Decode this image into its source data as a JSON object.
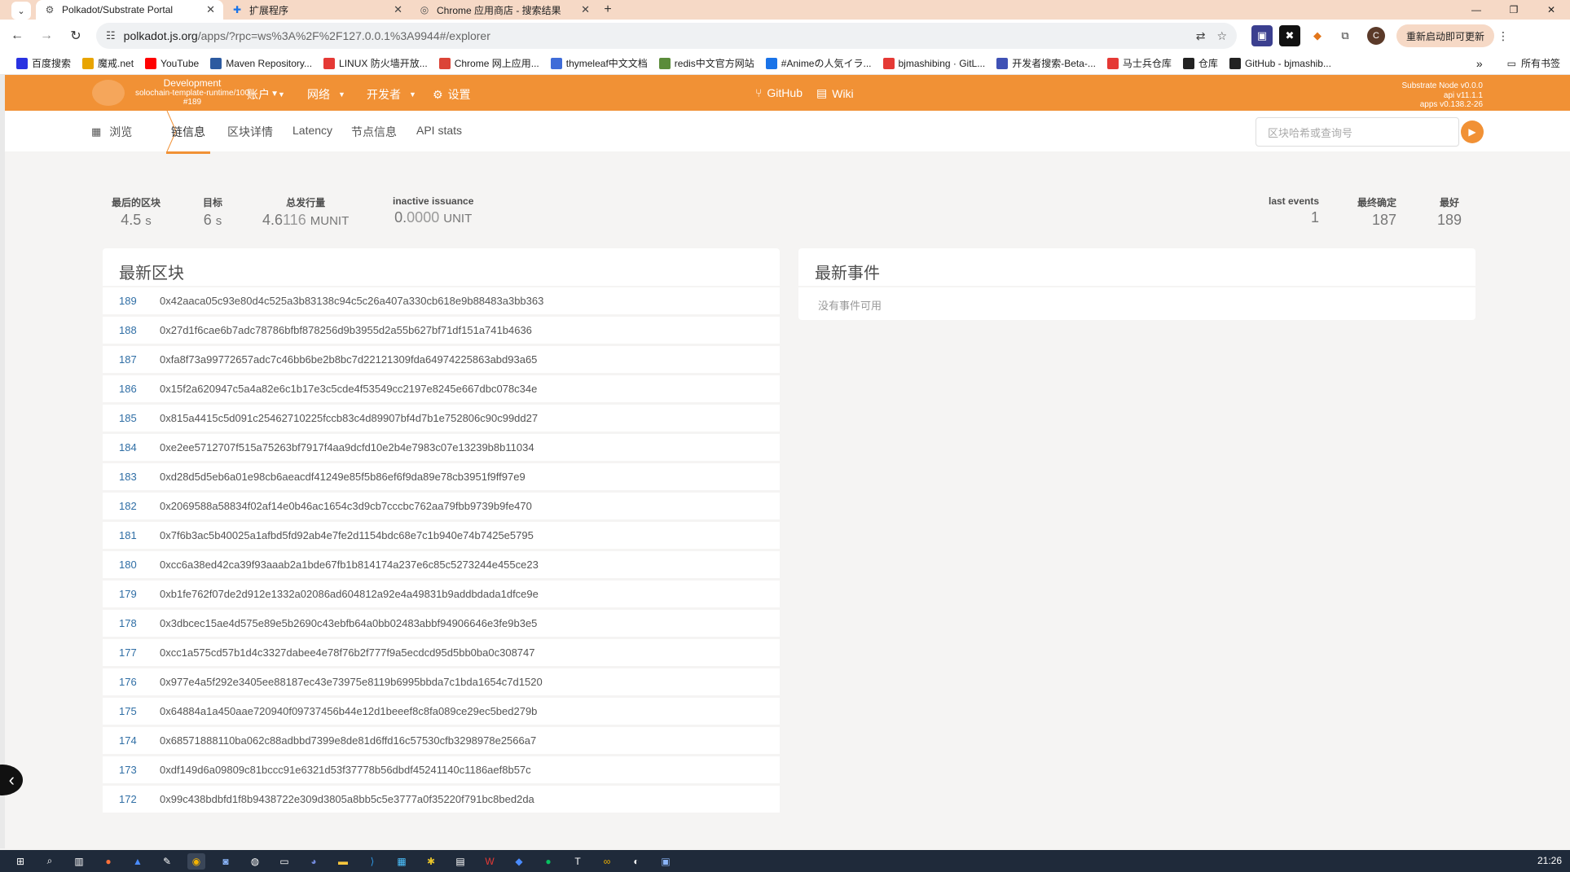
{
  "browser": {
    "tabs": [
      {
        "title": "Polkadot/Substrate Portal",
        "icon": "gear-icon",
        "active": true
      },
      {
        "title": "扩展程序",
        "icon": "puzzle-icon",
        "active": false
      },
      {
        "title": "Chrome 应用商店 - 搜索结果",
        "icon": "globe-icon",
        "active": false
      }
    ],
    "url_host": "polkadot.js.org",
    "url_path": "/apps/?rpc=ws%3A%2F%2F127.0.0.1%3A9944#/explorer",
    "profile_initial": "C",
    "update_label": "重新启动即可更新",
    "bookmarks": [
      {
        "label": "百度搜索",
        "color": "#2932e1"
      },
      {
        "label": "魔戒.net",
        "color": "#e8a400"
      },
      {
        "label": "YouTube",
        "color": "#ff0000"
      },
      {
        "label": "Maven Repository...",
        "color": "#2c5aa0"
      },
      {
        "label": "LINUX 防火墙开放...",
        "color": "#e53935"
      },
      {
        "label": "Chrome 网上应用...",
        "color": "#db4437"
      },
      {
        "label": "thymeleaf中文文档",
        "color": "#3f6cd8"
      },
      {
        "label": "redis中文官方网站",
        "color": "#5b8c3a"
      },
      {
        "label": "#Animeの人気イラ...",
        "color": "#1a73e8"
      },
      {
        "label": "bjmashibing · GitL...",
        "color": "#e53935"
      },
      {
        "label": "开发者搜索-Beta-...",
        "color": "#3f51b5"
      },
      {
        "label": "马士兵仓库",
        "color": "#e53935"
      },
      {
        "label": "仓库",
        "color": "#222222"
      },
      {
        "label": "GitHub - bjmashib...",
        "color": "#222222"
      }
    ],
    "all_bookmarks_label": "所有书签"
  },
  "header": {
    "network": "Development",
    "runtime": "solochain-template-runtime/100",
    "block": "#189",
    "menus": [
      {
        "label": "账户"
      },
      {
        "label": "网络"
      },
      {
        "label": "开发者"
      },
      {
        "label": "设置"
      }
    ],
    "links": [
      {
        "label": "GitHub"
      },
      {
        "label": "Wiki"
      }
    ],
    "node_name": "Substrate Node v0.0.0",
    "api_version": "api v11.1.1",
    "apps_version": "apps v0.138.2-26"
  },
  "subnav": {
    "browse_label": "浏览",
    "tabs": [
      "链信息",
      "区块详情",
      "Latency",
      "节点信息",
      "API stats"
    ],
    "search_placeholder": "区块哈希或查询号"
  },
  "stats": {
    "last_block": {
      "label": "最后的区块",
      "value": "4.5",
      "unit": "s"
    },
    "target": {
      "label": "目标",
      "value": "6",
      "unit": "s"
    },
    "total_issuance": {
      "label": "总发行量",
      "value_main": "4.6",
      "value_dim": "116",
      "unit": "MUNIT"
    },
    "inactive_issuance": {
      "label": "inactive issuance",
      "value_main": "0.",
      "value_dim": "0000",
      "unit": "UNIT"
    },
    "last_events": {
      "label": "last events",
      "value": "1"
    },
    "finalized": {
      "label": "最终确定",
      "value": "187"
    },
    "best": {
      "label": "最好",
      "value": "189"
    }
  },
  "recent_blocks": {
    "title": "最新区块",
    "rows": [
      {
        "number": "189",
        "hash": "0x42aaca05c93e80d4c525a3b83138c94c5c26a407a330cb618e9b88483a3bb363"
      },
      {
        "number": "188",
        "hash": "0x27d1f6cae6b7adc78786bfbf878256d9b3955d2a55b627bf71df151a741b4636"
      },
      {
        "number": "187",
        "hash": "0xfa8f73a99772657adc7c46bb6be2b8bc7d22121309fda64974225863abd93a65"
      },
      {
        "number": "186",
        "hash": "0x15f2a620947c5a4a82e6c1b17e3c5cde4f53549cc2197e8245e667dbc078c34e"
      },
      {
        "number": "185",
        "hash": "0x815a4415c5d091c25462710225fccb83c4d89907bf4d7b1e752806c90c99dd27"
      },
      {
        "number": "184",
        "hash": "0xe2ee5712707f515a75263bf7917f4aa9dcfd10e2b4e7983c07e13239b8b11034"
      },
      {
        "number": "183",
        "hash": "0xd28d5d5eb6a01e98cb6aeacdf41249e85f5b86ef6f9da89e78cb3951f9ff97e9"
      },
      {
        "number": "182",
        "hash": "0x2069588a58834f02af14e0b46ac1654c3d9cb7cccbc762aa79fbb9739b9fe470"
      },
      {
        "number": "181",
        "hash": "0x7f6b3ac5b40025a1afbd5fd92ab4e7fe2d1154bdc68e7c1b940e74b7425e5795"
      },
      {
        "number": "180",
        "hash": "0xcc6a38ed42ca39f93aaab2a1bde67fb1b814174a237e6c85c5273244e455ce23"
      },
      {
        "number": "179",
        "hash": "0xb1fe762f07de2d912e1332a02086ad604812a92e4a49831b9addbdada1dfce9e"
      },
      {
        "number": "178",
        "hash": "0x3dbcec15ae4d575e89e5b2690c43ebfb64a0bb02483abbf94906646e3fe9b3e5"
      },
      {
        "number": "177",
        "hash": "0xcc1a575cd57b1d4c3327dabee4e78f76b2f777f9a5ecdcd95d5bb0ba0c308747"
      },
      {
        "number": "176",
        "hash": "0x977e4a5f292e3405ee88187ec43e73975e8119b6995bbda7c1bda1654c7d1520"
      },
      {
        "number": "175",
        "hash": "0x64884a1a450aae720940f09737456b44e12d1beeef8c8fa089ce29ec5bed279b"
      },
      {
        "number": "174",
        "hash": "0x68571888110ba062c88adbbd7399e8de81d6ffd16c57530cfb3298978e2566a7"
      },
      {
        "number": "173",
        "hash": "0xdf149d6a09809c81bccc91e6321d53f37778b56dbdf45241140c1186aef8b57c"
      },
      {
        "number": "172",
        "hash": "0x99c438bdbfd1f8b9438722e309d3805a8bb5c5e3777a0f35220f791bc8bed2da"
      }
    ]
  },
  "recent_events": {
    "title": "最新事件",
    "empty_text": "没有事件可用"
  },
  "taskbar": {
    "time": "21:26"
  },
  "colors": {
    "accent": "#f19135",
    "link": "#2f6ea5"
  }
}
